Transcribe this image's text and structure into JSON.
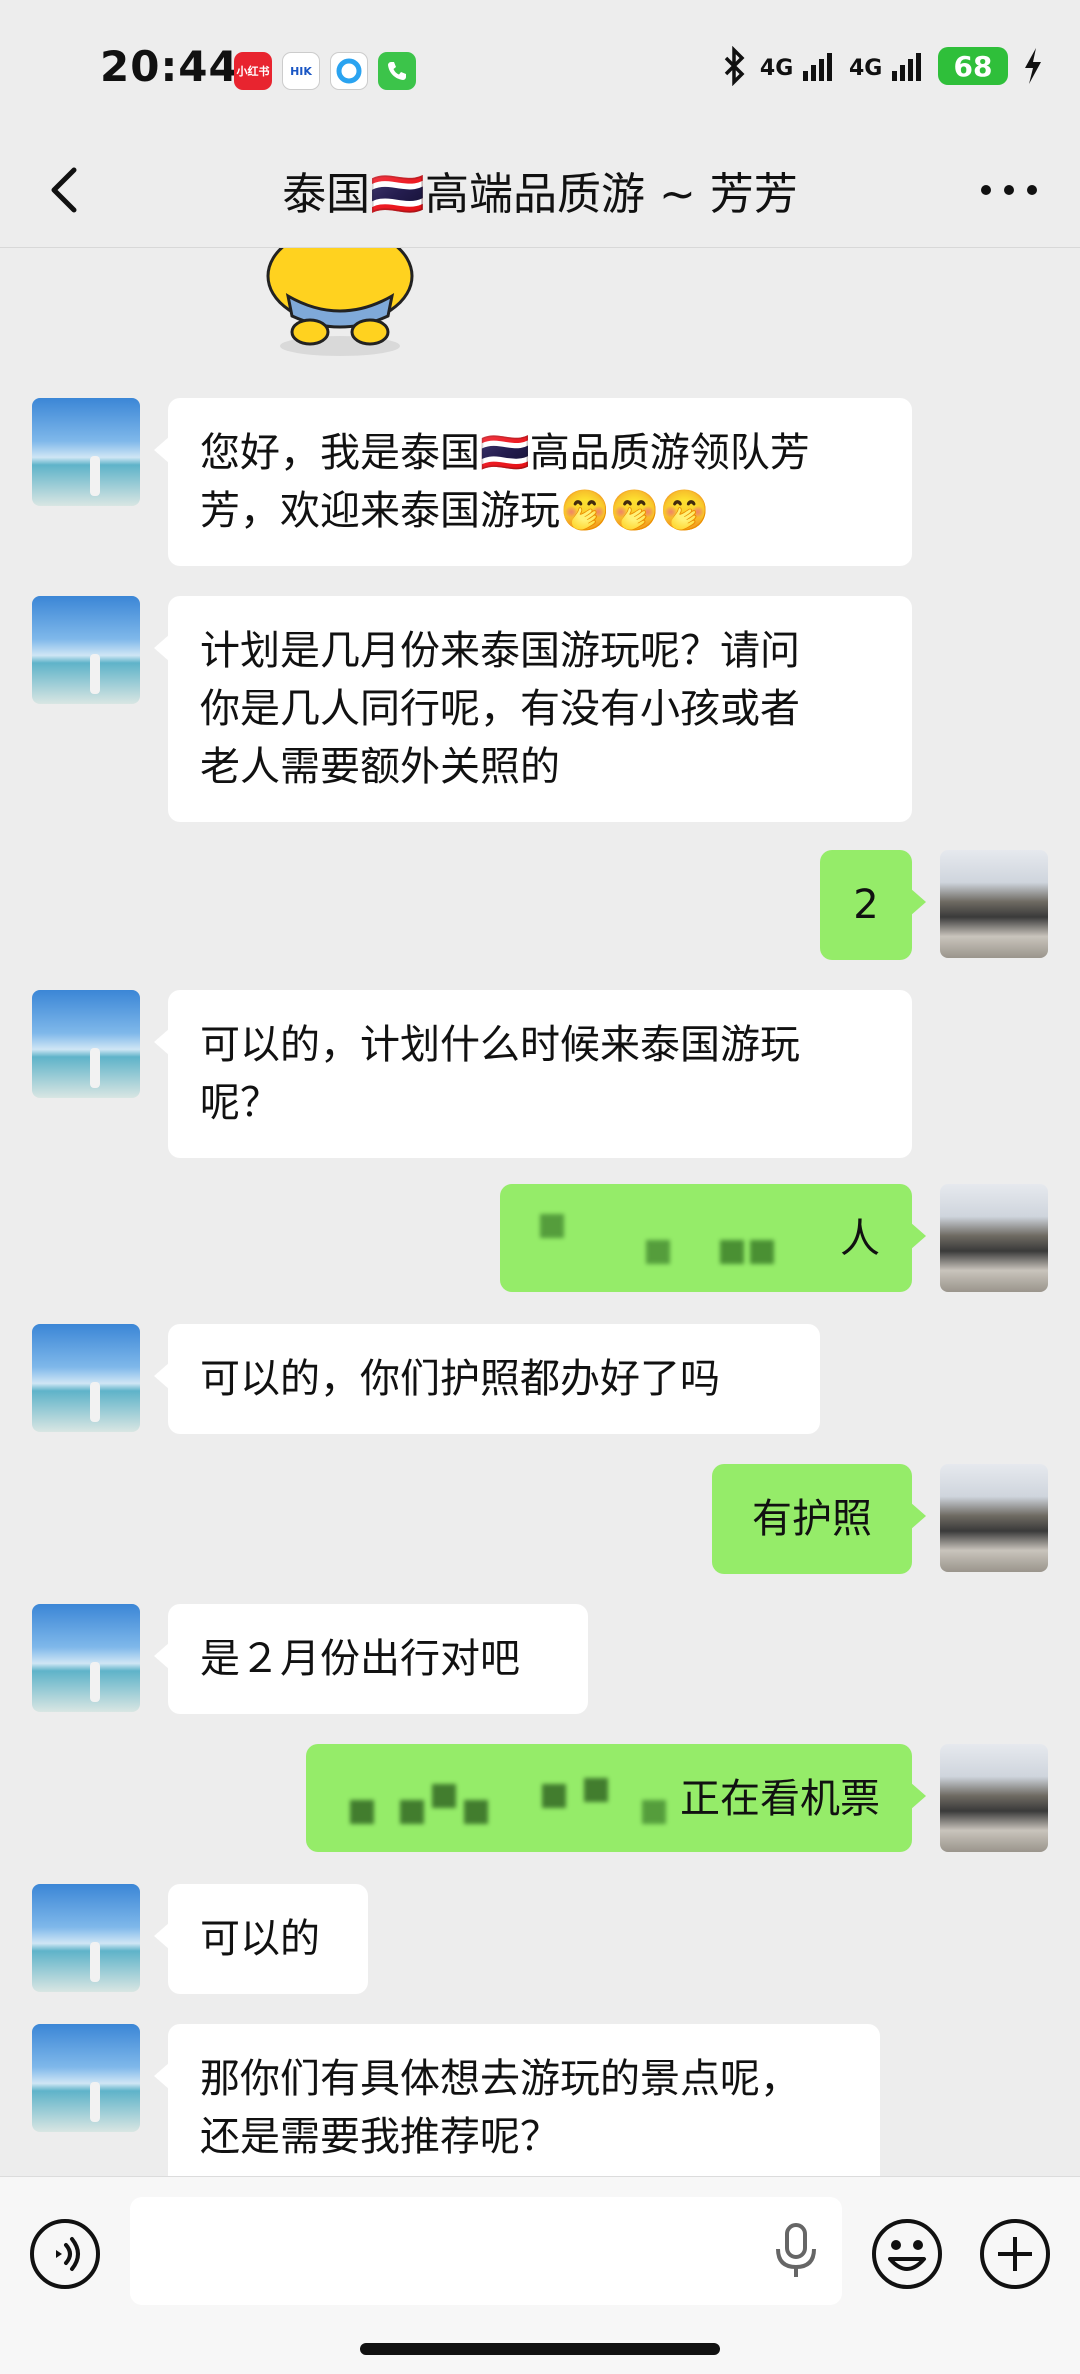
{
  "status_bar": {
    "time": "20:44",
    "apps": [
      {
        "name": "app-badge-xiaohongshu",
        "label": "小红书",
        "color": "#e8242f"
      },
      {
        "name": "app-badge-hikvision",
        "label": "HIK",
        "color": "#1a56c4"
      },
      {
        "name": "app-badge-browser",
        "label": "",
        "color": "#2aa3f0"
      },
      {
        "name": "app-badge-phone",
        "label": "",
        "color": "#3cc44a"
      }
    ],
    "signal_1": "4G",
    "signal_2": "4G",
    "battery": "68"
  },
  "header": {
    "title": "泰国🇹🇭高端品质游 ~ 芳芳"
  },
  "messages": [
    {
      "side": "in",
      "text": "您好，我是泰国🇹🇭高品质游领队芳\n芳，欢迎来泰国游玩🤭🤭🤭"
    },
    {
      "side": "in",
      "text": "计划是几月份来泰国游玩呢？请问\n你是几人同行呢，有没有小孩或者\n老人需要额外关照的"
    },
    {
      "side": "out",
      "text": "2"
    },
    {
      "side": "in",
      "text": "可以的，计划什么时候来泰国游玩\n呢？"
    },
    {
      "side": "out",
      "text": "人",
      "blurred": true
    },
    {
      "side": "in",
      "text": "可以的，你们护照都办好了吗"
    },
    {
      "side": "out",
      "text": "有护照"
    },
    {
      "side": "in",
      "text": "是２月份出行对吧"
    },
    {
      "side": "out",
      "text": "正在看机票",
      "blurred": true
    },
    {
      "side": "in",
      "text": "可以的"
    },
    {
      "side": "in",
      "text": "那你们有具体想去游玩的景点呢，\n还是需要我推荐呢？"
    }
  ],
  "input": {
    "placeholder": ""
  }
}
